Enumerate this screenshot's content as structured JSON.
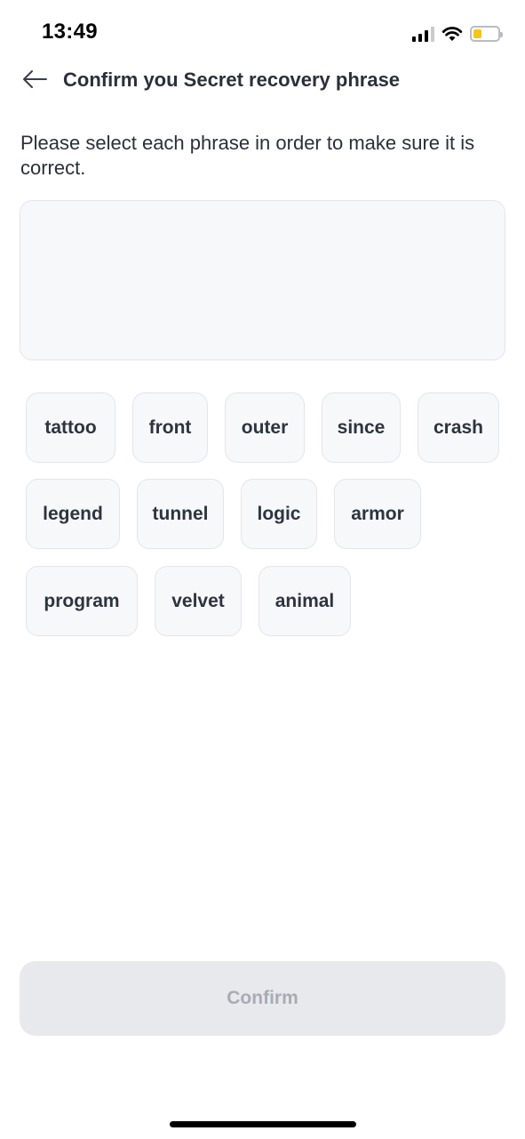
{
  "status_bar": {
    "time": "13:49"
  },
  "header": {
    "title": "Confirm you Secret recovery phrase"
  },
  "instruction": "Please select each phrase in order to make sure it is correct.",
  "words": [
    "tattoo",
    "front",
    "outer",
    "since",
    "crash",
    "legend",
    "tunnel",
    "logic",
    "armor",
    "program",
    "velvet",
    "animal"
  ],
  "confirm_label": "Confirm",
  "colors": {
    "confirm_disabled_bg": "#e8e9ed",
    "battery_fill": "#f5c518"
  },
  "icons": {
    "back": "arrow-left-icon",
    "signal": "cellular-signal-icon",
    "wifi": "wifi-icon",
    "battery": "battery-icon"
  }
}
